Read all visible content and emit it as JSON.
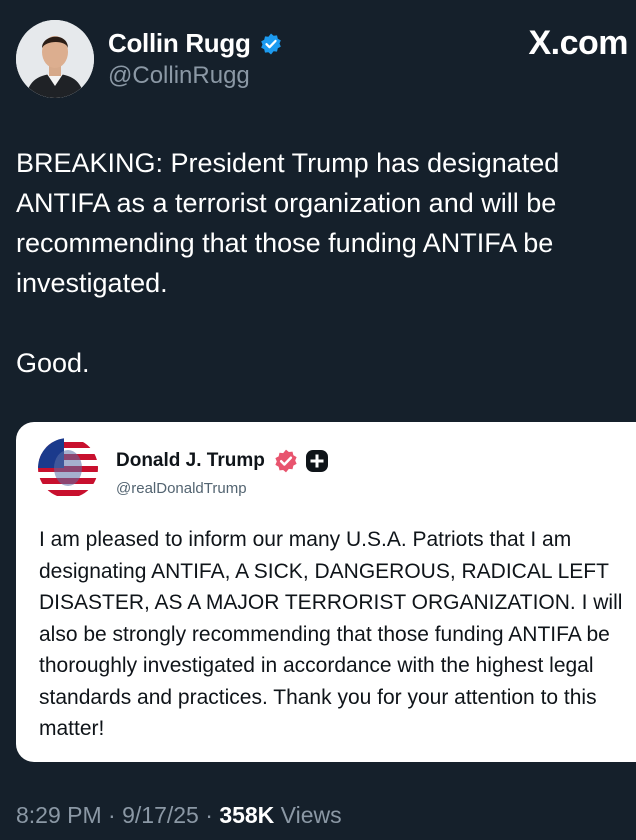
{
  "author": {
    "display_name": "Collin Rugg",
    "handle": "@CollinRugg",
    "verified_badge": "verified-check-icon",
    "badge_color": "#1d9bf0"
  },
  "source": "X.com",
  "tweet": {
    "paragraphs": [
      "BREAKING: President Trump has designated ANTIFA as a terrorist organization and will be recommending that those funding ANTIFA be investigated.",
      "Good."
    ]
  },
  "quoted": {
    "display_name": "Donald J. Trump",
    "handle": "@realDonaldTrump",
    "badge_color": "#e0245e",
    "text": "I am pleased to inform our many U.S.A. Patriots that I am designating ANTIFA, A SICK, DANGEROUS, RADICAL LEFT DISASTER, AS A MAJOR TERRORIST ORGANIZATION. I will also be strongly recommending that those funding ANTIFA be thoroughly investigated in accordance with the highest legal standards and practices. Thank you for your attention to this matter!"
  },
  "meta": {
    "time": "8:29 PM",
    "sep1": " · ",
    "date": "9/17/25",
    "sep2": " · ",
    "views_count": "358K",
    "views_label": " Views"
  },
  "colors": {
    "background": "#15202b",
    "secondary_text": "#8b98a5",
    "card": "#ffffff"
  }
}
